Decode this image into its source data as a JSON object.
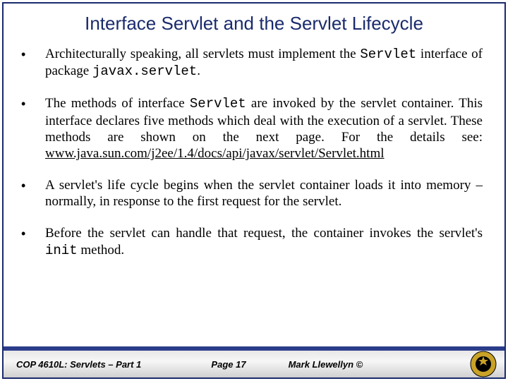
{
  "title": "Interface Servlet and the Servlet Lifecycle",
  "bullets": [
    {
      "pre1": "Architecturally speaking, all servlets must implement the ",
      "mono1": "Servlet",
      "mid1": " interface of package ",
      "mono2": "javax.servlet",
      "post1": "."
    },
    {
      "pre1": "The methods of interface ",
      "mono1": "Servlet",
      "mid1": " are invoked by the servlet container.  This interface declares  five methods which deal with the execution of a servlet.  These methods are shown on the next page.   For the details see: ",
      "link": "www.java.sun.com/j2ee/1.4/docs/api/javax/servlet/Servlet.html"
    },
    {
      "text": "A servlet's life cycle begins when the servlet container loads it into memory – normally, in response to the first request for the servlet."
    },
    {
      "pre1": "Before the servlet can handle that request, the container invokes the servlet's ",
      "mono1": "init",
      "post1": " method."
    }
  ],
  "footer": {
    "left": "COP 4610L: Servlets – Part 1",
    "center": "Page 17",
    "right": "Mark Llewellyn ©"
  }
}
